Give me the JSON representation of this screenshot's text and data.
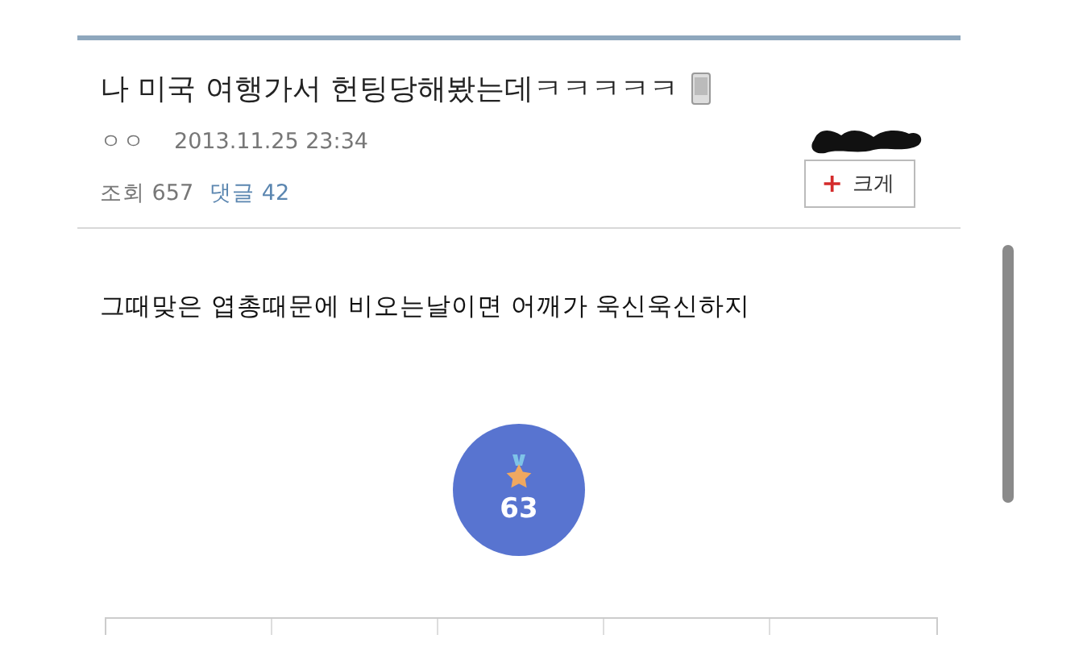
{
  "post": {
    "title": "나 미국 여행가서 헌팅당해봤는데ㅋㅋㅋㅋㅋ",
    "author": "ㅇㅇ",
    "date": "2013.11.25 23:34",
    "views_label": "조회",
    "views": "657",
    "comments_label": "댓글",
    "comments": "42",
    "zoom_button": {
      "icon": "+",
      "label": "크게"
    }
  },
  "body": "그때맞은 엽총때문에 비오는날이면 어깨가 욱신욱신하지",
  "recommend": {
    "count": "63"
  }
}
